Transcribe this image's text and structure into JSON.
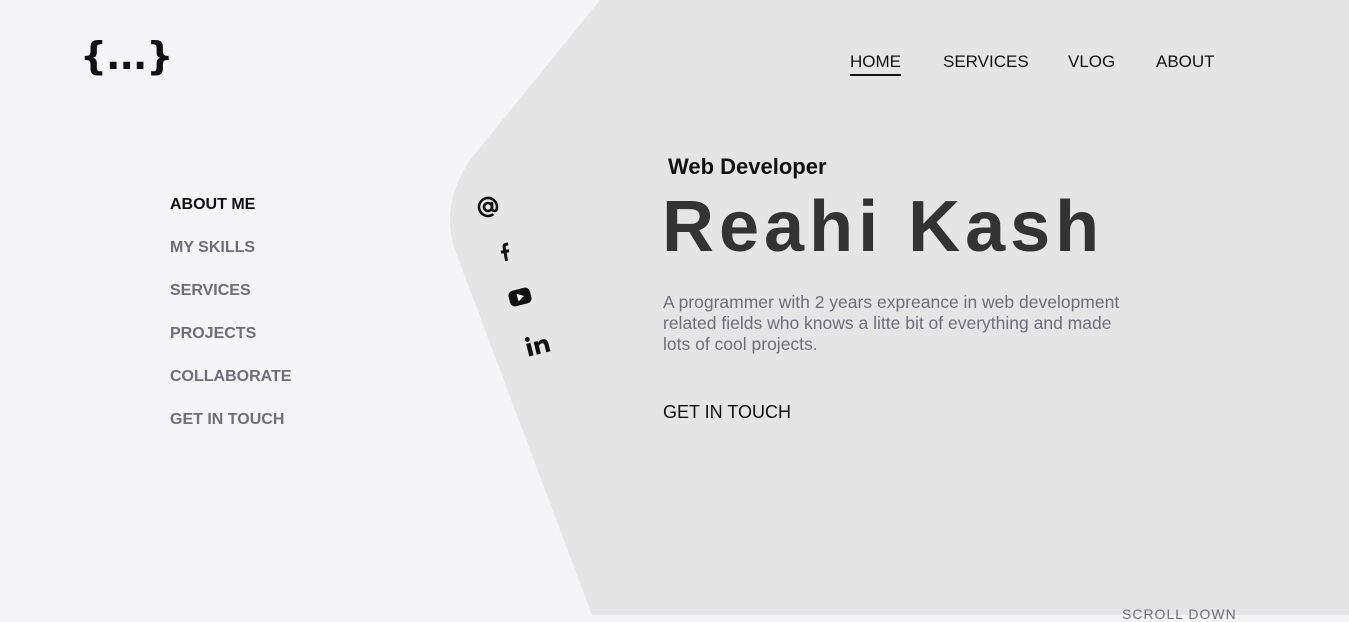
{
  "brand": {
    "logo": "{...}"
  },
  "nav": {
    "items": [
      {
        "label": "HOME",
        "active": true
      },
      {
        "label": "SERVICES"
      },
      {
        "label": "VLOG"
      },
      {
        "label": "ABOUT"
      }
    ]
  },
  "side_menu": {
    "items": [
      {
        "label": "ABOUT ME",
        "active": true
      },
      {
        "label": "MY SKILLS"
      },
      {
        "label": "SERVICES"
      },
      {
        "label": "PROJECTS"
      },
      {
        "label": "COLLABORATE"
      },
      {
        "label": "GET IN TOUCH"
      }
    ]
  },
  "social": {
    "icons": [
      "email-icon",
      "facebook-icon",
      "youtube-icon",
      "linkedin-icon"
    ]
  },
  "hero": {
    "subtitle": "Web Developer",
    "name": "Reahi Kash",
    "bio": "A programmer with 2 years expreance in web development related fields who knows a litte bit of everything and made lots of cool projects.",
    "cta": "GET IN TOUCH"
  },
  "scroll_hint": "SCROLL DOWN",
  "colors": {
    "background": "#f5f5f7",
    "panel": "#e5e5e6",
    "text": "#111111",
    "muted": "#6e6e7a",
    "heading": "#333333"
  }
}
